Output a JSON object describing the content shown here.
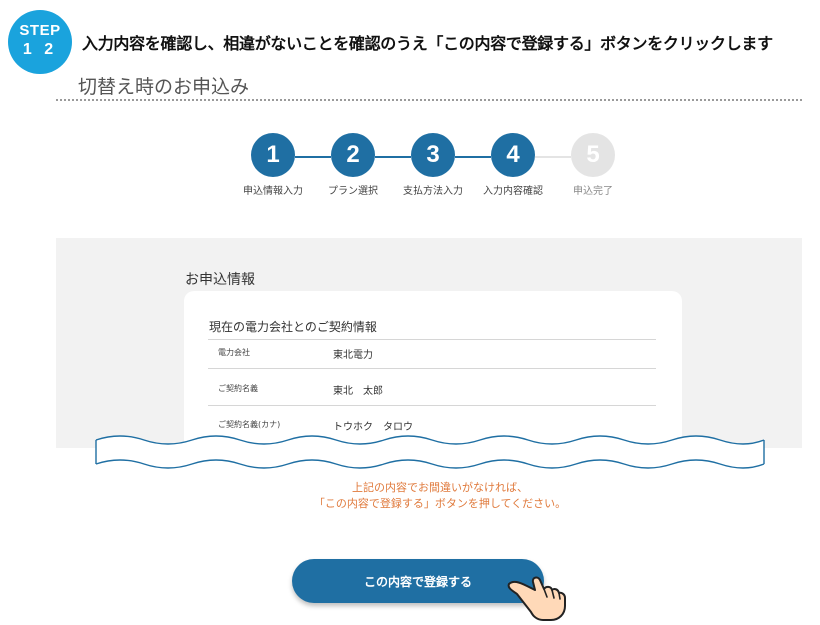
{
  "step": {
    "label": "STEP",
    "number": "1 2"
  },
  "instruction": "入力内容を確認し、相違がないことを確認のうえ「この内容で登録する」ボタンをクリックします",
  "page_title": "切替え時のお申込み",
  "progress": {
    "current": 4,
    "steps": [
      {
        "number": "1",
        "label": "申込情報入力",
        "state": "done"
      },
      {
        "number": "2",
        "label": "プラン選択",
        "state": "done"
      },
      {
        "number": "3",
        "label": "支払方法入力",
        "state": "done"
      },
      {
        "number": "4",
        "label": "入力内容確認",
        "state": "current"
      },
      {
        "number": "5",
        "label": "申込完了",
        "state": "pending"
      }
    ]
  },
  "colors": {
    "accent": "#1f6fa3",
    "step_badge": "#1aa3dd",
    "pending": "#e4e4e4",
    "notice": "#e07a3c",
    "panel": "#f2f2f2"
  },
  "application": {
    "heading": "お申込情報",
    "card_heading": "現在の電力会社とのご契約情報",
    "rows": [
      {
        "label": "電力会社",
        "value": "東北電力"
      },
      {
        "label": "ご契約名義",
        "value": "東北　太郎"
      },
      {
        "label": "ご契約名義(カナ)",
        "value": "トウホク　タロウ"
      }
    ]
  },
  "notice": {
    "line1": "上記の内容でお間違いがなければ、",
    "line2": "「この内容で登録する」ボタンを押してください。"
  },
  "register_button": {
    "label": "この内容で登録する"
  },
  "icons": {
    "pointer": "pointing-hand-icon"
  }
}
